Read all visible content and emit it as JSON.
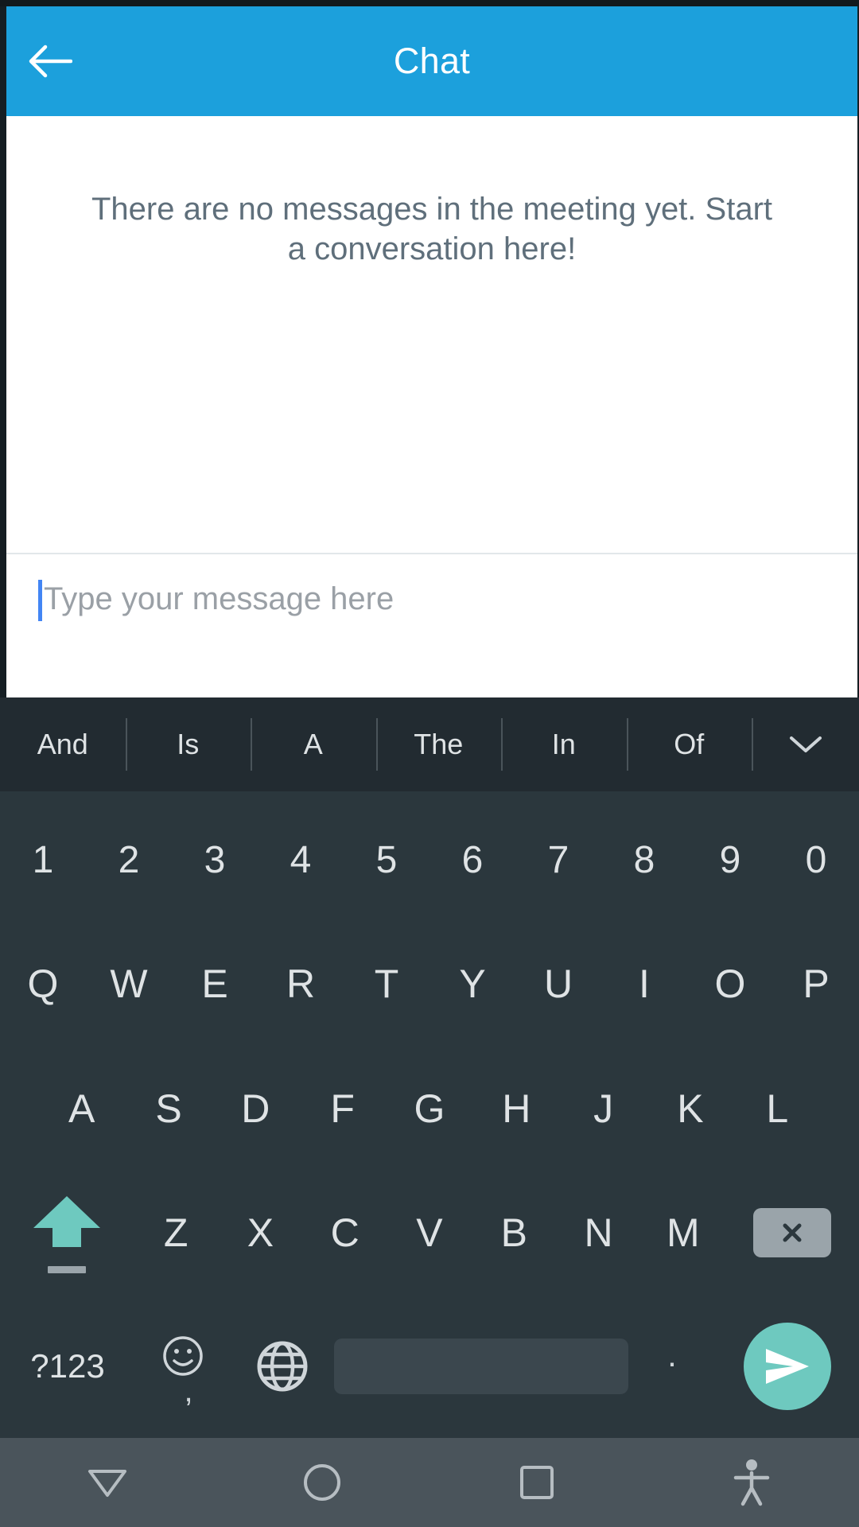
{
  "header": {
    "title": "Chat",
    "back_icon": "back-arrow-icon",
    "bg_color": "#1ca0dc",
    "text_color": "#ffffff"
  },
  "messages": {
    "empty_state": "There are no messages in the meeting yet. Start a conversation here!",
    "empty_state_color": "#5f6f7b"
  },
  "composer": {
    "placeholder": "Type your message here",
    "value": "",
    "caret_color": "#4285f4",
    "placeholder_color": "#9aa0a6"
  },
  "keyboard": {
    "suggestions": [
      "And",
      "Is",
      "A",
      "The",
      "In",
      "Of"
    ],
    "expand_icon": "chevron-down-icon",
    "rows": {
      "numbers": [
        "1",
        "2",
        "3",
        "4",
        "5",
        "6",
        "7",
        "8",
        "9",
        "0"
      ],
      "top": [
        "Q",
        "W",
        "E",
        "R",
        "T",
        "Y",
        "U",
        "I",
        "O",
        "P"
      ],
      "home": [
        "A",
        "S",
        "D",
        "F",
        "G",
        "H",
        "J",
        "K",
        "L"
      ],
      "bottom": [
        "Z",
        "X",
        "C",
        "V",
        "B",
        "N",
        "M"
      ]
    },
    "shift_icon": "shift-arrow-icon",
    "shift_color": "#6ec9bf",
    "backspace_icon": "backspace-icon",
    "symbols_label": "?123",
    "emoji_icon": "smiley-icon",
    "emoji_comma": ",",
    "globe_icon": "globe-icon",
    "space_label": "",
    "period_label": ".",
    "send_icon": "send-icon",
    "send_color": "#6ec9bf",
    "bg_color": "#2b373d",
    "suggestion_bg_color": "#222b31",
    "key_text_color": "#dfe3e5"
  },
  "navbar": {
    "back_icon": "nav-back-triangle-icon",
    "home_icon": "nav-home-circle-icon",
    "recents_icon": "nav-recents-square-icon",
    "accessibility_icon": "accessibility-icon",
    "bg_color": "#4a545b"
  }
}
